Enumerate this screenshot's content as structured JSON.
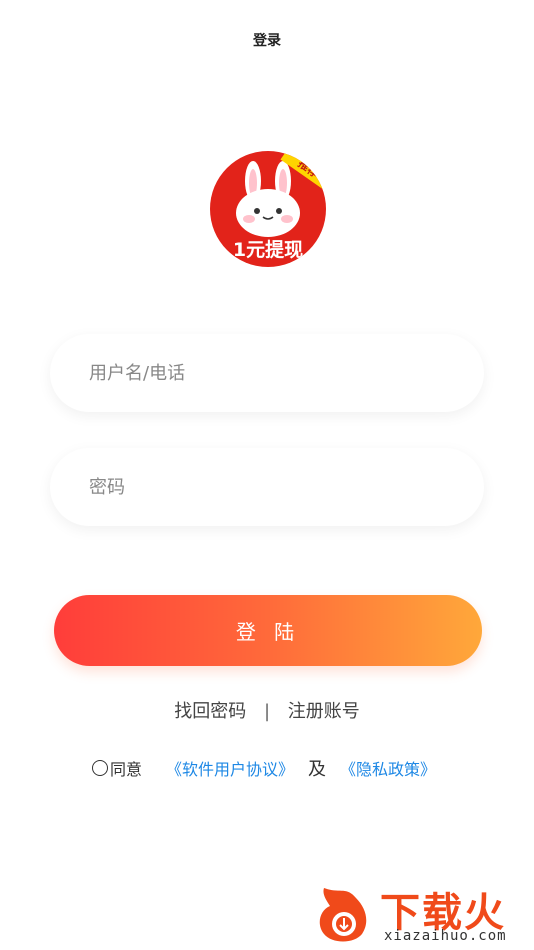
{
  "header": {
    "title": "登录"
  },
  "logo": {
    "ribbon": "推荐",
    "caption": "1元提现"
  },
  "form": {
    "username_placeholder": "用户名/电话",
    "password_placeholder": "密码",
    "login_label": "登 陆"
  },
  "links": {
    "retrieve_password": "找回密码",
    "separator": "|",
    "register": "注册账号"
  },
  "agreement": {
    "agree": "同意",
    "user_agreement": "《软件用户协议》",
    "and": "及",
    "privacy_policy": "《隐私政策》"
  },
  "watermark": {
    "name": "下载火",
    "url": "xiazaihuo.com"
  },
  "colors": {
    "gradient_start": "#ff3d3a",
    "gradient_end": "#ffa83a",
    "link": "#1e88e5",
    "logo_bg": "#e2231a"
  }
}
